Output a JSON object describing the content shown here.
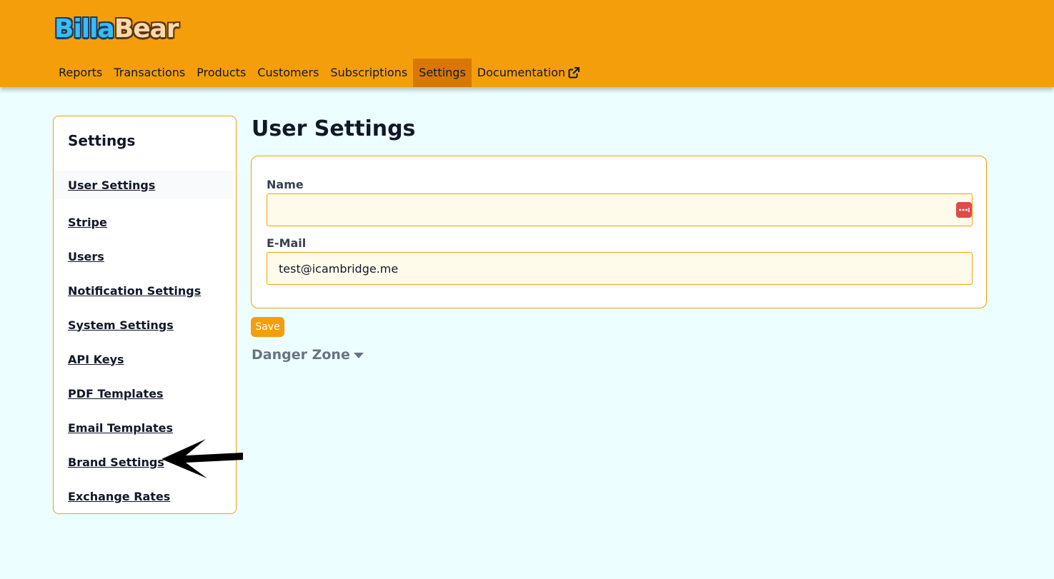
{
  "brand": {
    "part1": "Billa",
    "part2": "Bear"
  },
  "nav": {
    "items": [
      {
        "label": "Reports"
      },
      {
        "label": "Transactions"
      },
      {
        "label": "Products"
      },
      {
        "label": "Customers"
      },
      {
        "label": "Subscriptions"
      },
      {
        "label": "Settings",
        "active": true
      },
      {
        "label": "Documentation",
        "icon": "external-link-icon"
      }
    ]
  },
  "sidebar": {
    "title": "Settings",
    "items": [
      {
        "label": "User Settings",
        "active": true
      },
      {
        "label": "Stripe"
      },
      {
        "label": "Users"
      },
      {
        "label": "Notification Settings"
      },
      {
        "label": "System Settings"
      },
      {
        "label": "API Keys"
      },
      {
        "label": "PDF Templates"
      },
      {
        "label": "Email Templates"
      },
      {
        "label": "Brand Settings"
      },
      {
        "label": "Exchange Rates"
      }
    ]
  },
  "main": {
    "title": "User Settings",
    "form": {
      "name_label": "Name",
      "name_value": "",
      "email_label": "E-Mail",
      "email_value": "test@icambridge.me"
    },
    "save_label": "Save",
    "danger_zone_label": "Danger Zone"
  },
  "colors": {
    "header": "#f59e0b",
    "nav_active": "#d97706",
    "background": "#ecfeff",
    "accent": "#f59e0b",
    "input_bg": "#fffbeb"
  },
  "icons": {
    "password_manager": "password-manager-icon",
    "external_link": "external-link-icon",
    "caret": "caret-down-icon"
  }
}
